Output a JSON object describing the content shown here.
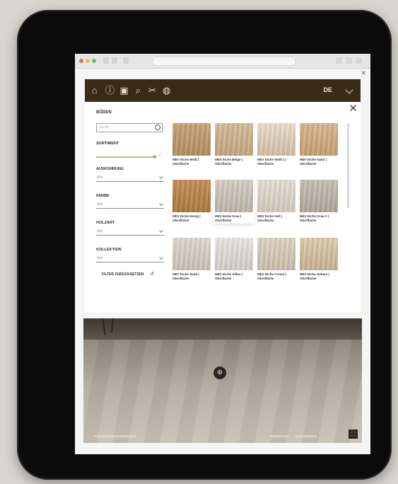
{
  "browser": {
    "url": "",
    "icons": [
      "back-icon",
      "forward-icon",
      "sidebar-icon",
      "share-icon",
      "tabs-icon",
      "add-tab-icon"
    ]
  },
  "toolbar": {
    "icons": [
      "home-icon",
      "info-icon",
      "calendar-icon",
      "search-icon",
      "tools-icon",
      "globe-icon"
    ],
    "language": "DE"
  },
  "sidebar": {
    "title": "BÖDEN",
    "search_placeholder": "Suche",
    "filters": [
      {
        "label": "SORTIMENT",
        "value": ""
      },
      {
        "label": "AUSFÜHRUNG",
        "value": "Alle"
      },
      {
        "label": "FARBE",
        "value": "Alle"
      },
      {
        "label": "HOLZART",
        "value": "Alle"
      },
      {
        "label": "KOLLEKTION",
        "value": "Alle"
      }
    ],
    "reset_label": "FILTER ZURÜCKSETZEN"
  },
  "tiles": [
    {
      "caption": "MEV Eiche Weiß | Oberfläche",
      "color1": "#c9a37a",
      "color2": "#b48a60"
    },
    {
      "caption": "MEV Eiche Beige | Oberfläche",
      "color1": "#d3bb98",
      "color2": "#c2a47c"
    },
    {
      "caption": "MEV Eiche Weiß 2 | Oberfläche",
      "color1": "#e9ddcc",
      "color2": "#d1bda2"
    },
    {
      "caption": "MEV Eiche Natur | Oberfläche",
      "color1": "#d6b68d",
      "color2": "#c49e72"
    },
    {
      "caption": "MEV Eiche Honig | Oberfläche",
      "color1": "#c28f55",
      "color2": "#a97640"
    },
    {
      "caption": "MEV Eiche Grau | Oberfläche",
      "color1": "#d4cdc4",
      "color2": "#bdb4a9"
    },
    {
      "caption": "MEV Eiche Hell | Oberfläche",
      "color1": "#e4ddd3",
      "color2": "#d1c8bb"
    },
    {
      "caption": "MEV Eiche Grau 2 | Oberfläche",
      "color1": "#c7bfb5",
      "color2": "#aea498"
    },
    {
      "caption": "MEV Eiche Sand | Oberfläche",
      "color1": "#ddd6cc",
      "color2": "#c9c0b3"
    },
    {
      "caption": "MEV Eiche Silber | Oberfläche",
      "color1": "#e7e5e2",
      "color2": "#cfccc7"
    },
    {
      "caption": "MEV Eiche Creme | Oberfläche",
      "color1": "#ddd3c4",
      "color2": "#c8bca9"
    },
    {
      "caption": "MEV Eiche Sahara | Oberfläche",
      "color1": "#ddcbad",
      "color2": "#c6b08e"
    }
  ],
  "strips": [
    "#c9a57b",
    "#b08e6a",
    "#d9c2a0",
    "#8e7257"
  ],
  "selected_tile_index": 5,
  "preview": {
    "zoom_icon": "zoom-icon",
    "fullscreen_icon": "fullscreen-icon"
  }
}
